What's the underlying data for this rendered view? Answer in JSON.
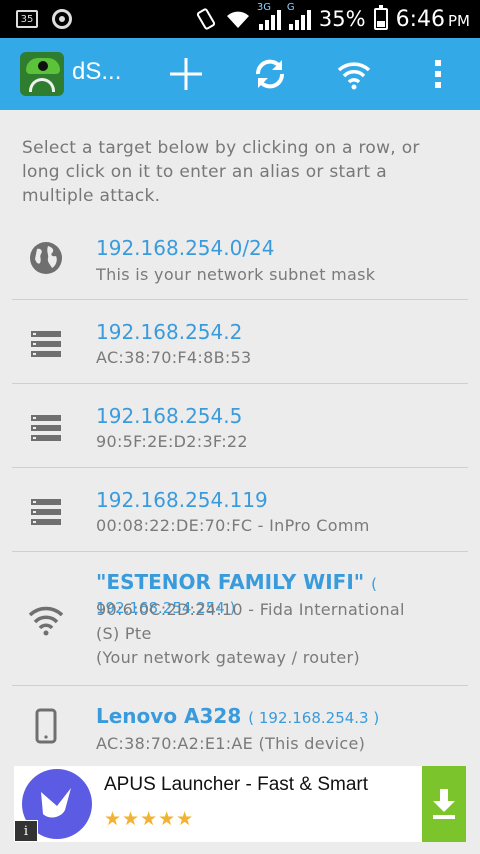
{
  "status_bar": {
    "badge": "35",
    "network1_tag": "3G",
    "network2_tag": "G",
    "battery": "35%",
    "time": "6:46",
    "ampm": "PM"
  },
  "app_bar": {
    "title": "dS...",
    "actions": [
      "add-icon",
      "refresh-icon",
      "wifi-icon",
      "overflow-menu-icon"
    ]
  },
  "intro_text": "Select a target below by clicking on a row, or long click on it to enter an alias or start a multiple attack.",
  "targets": [
    {
      "icon": "globe-icon",
      "title": "192.168.254.0/24",
      "ip": "",
      "subtitle": "This is your network subnet mask"
    },
    {
      "icon": "server-icon",
      "title": "192.168.254.2",
      "ip": "",
      "subtitle": "AC:38:70:F4:8B:53"
    },
    {
      "icon": "server-icon",
      "title": "192.168.254.5",
      "ip": "",
      "subtitle": "90:5F:2E:D2:3F:22"
    },
    {
      "icon": "server-icon",
      "title": "192.168.254.119",
      "ip": "",
      "subtitle": "00:08:22:DE:70:FC - InPro Comm"
    },
    {
      "icon": "wifi-icon",
      "title": "\"ESTENOR FAMILY WIFI\"",
      "ip": "( 192.168.254.254 )",
      "subtitle_line1": "90:6:0C:2D:24:10 - Fida International",
      "subtitle_line2": "(S) Pte",
      "subtitle_line3": "(Your network gateway / router)"
    },
    {
      "icon": "phone-icon",
      "title": "Lenovo A328",
      "ip": "( 192.168.254.3 )",
      "subtitle": "AC:38:70:A2:E1:AE (This device)"
    }
  ],
  "ad": {
    "title": "APUS Launcher - Fast & Smart",
    "rating_stars": 4.5,
    "stars_text": "★★★★★",
    "info_label": "i"
  },
  "colors": {
    "app_bar": "#33a9e8",
    "link_blue": "#3a9bdc",
    "ad_download": "#7cc42b",
    "ad_logo": "#5b5ce3"
  }
}
